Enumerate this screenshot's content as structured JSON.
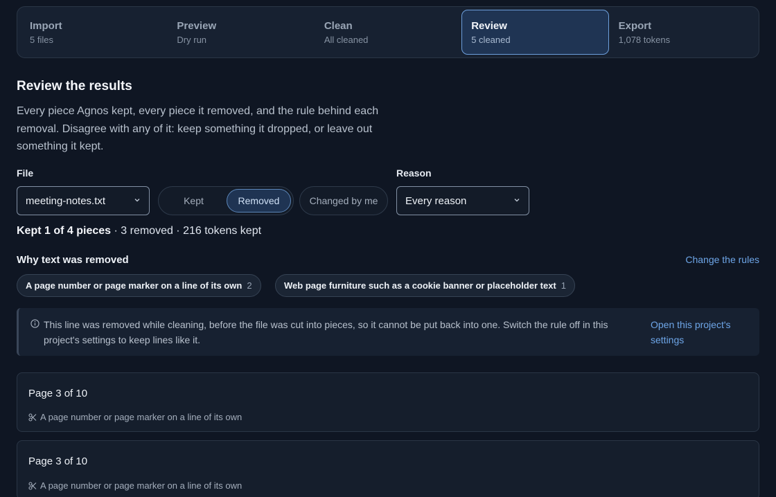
{
  "steps": [
    {
      "title": "Import",
      "subtitle": "5 files"
    },
    {
      "title": "Preview",
      "subtitle": "Dry run"
    },
    {
      "title": "Clean",
      "subtitle": "All cleaned"
    },
    {
      "title": "Review",
      "subtitle": "5 cleaned"
    },
    {
      "title": "Export",
      "subtitle": "1,078 tokens"
    }
  ],
  "active_step": "Review",
  "page": {
    "title": "Review the results",
    "description": "Every piece Agnos kept, every piece it removed, and the rule behind each removal. Disagree with any of it: keep something it dropped, or leave out something it kept."
  },
  "filters": {
    "file_label": "File",
    "file_value": "meeting-notes.txt",
    "segment": {
      "kept": "Kept",
      "removed": "Removed",
      "selected": "Removed"
    },
    "changed_by_me": "Changed by me",
    "reason_label": "Reason",
    "reason_value": "Every reason"
  },
  "summary": {
    "bold": "Kept 1 of 4 pieces",
    "rest": " · 3 removed · 216 tokens kept"
  },
  "why": {
    "heading": "Why text was removed",
    "change_link": "Change the rules",
    "chips": [
      {
        "label": "A page number or page marker on a line of its own",
        "count": "2"
      },
      {
        "label": "Web page furniture such as a cookie banner or placeholder text",
        "count": "1"
      }
    ]
  },
  "notice": {
    "text": "This line was removed while cleaning, before the file was cut into pieces, so it cannot be put back into one. Switch the rule off in this project's settings to keep lines like it.",
    "link": "Open this project's settings"
  },
  "pieces": [
    {
      "title": "Page 3 of 10",
      "rule": "A page number or page marker on a line of its own"
    },
    {
      "title": "Page 3 of 10",
      "rule": "A page number or page marker on a line of its own"
    }
  ],
  "colors": {
    "background": "#0f1623",
    "accent": "#6ea6e8",
    "active_step_bg": "#1f3453"
  },
  "icons": {
    "select_caret": "chevron-down-icon",
    "notice": "info-icon",
    "rule": "scissors-icon"
  }
}
